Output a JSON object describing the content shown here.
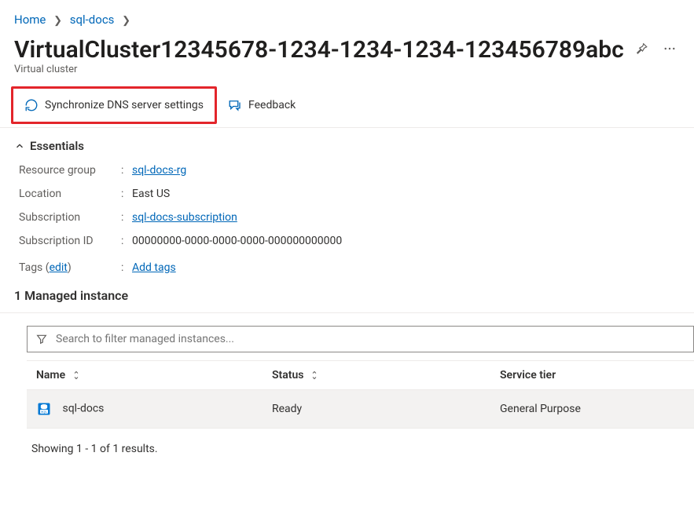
{
  "breadcrumbs": {
    "home": "Home",
    "folder": "sql-docs"
  },
  "page": {
    "title": "VirtualCluster12345678-1234-1234-1234-123456789abc",
    "subtitle": "Virtual cluster"
  },
  "commandbar": {
    "sync": "Synchronize DNS server settings",
    "feedback": "Feedback"
  },
  "essentials": {
    "header": "Essentials",
    "labels": {
      "resource_group": "Resource group",
      "location": "Location",
      "subscription": "Subscription",
      "subscription_id": "Subscription ID",
      "tags": "Tags",
      "edit": "edit",
      "add_tags": "Add tags"
    },
    "values": {
      "resource_group": "sql-docs-rg",
      "location": "East US",
      "subscription": "sql-docs-subscription",
      "subscription_id": "00000000-0000-0000-0000-000000000000"
    }
  },
  "section": {
    "managed_instance_heading": "1 Managed instance"
  },
  "search": {
    "placeholder": "Search to filter managed instances..."
  },
  "table": {
    "columns": {
      "name": "Name",
      "status": "Status",
      "tier": "Service tier"
    },
    "rows": [
      {
        "name": "sql-docs",
        "status": "Ready",
        "tier": "General Purpose"
      }
    ],
    "results_note": "Showing 1 - 1 of 1 results."
  }
}
